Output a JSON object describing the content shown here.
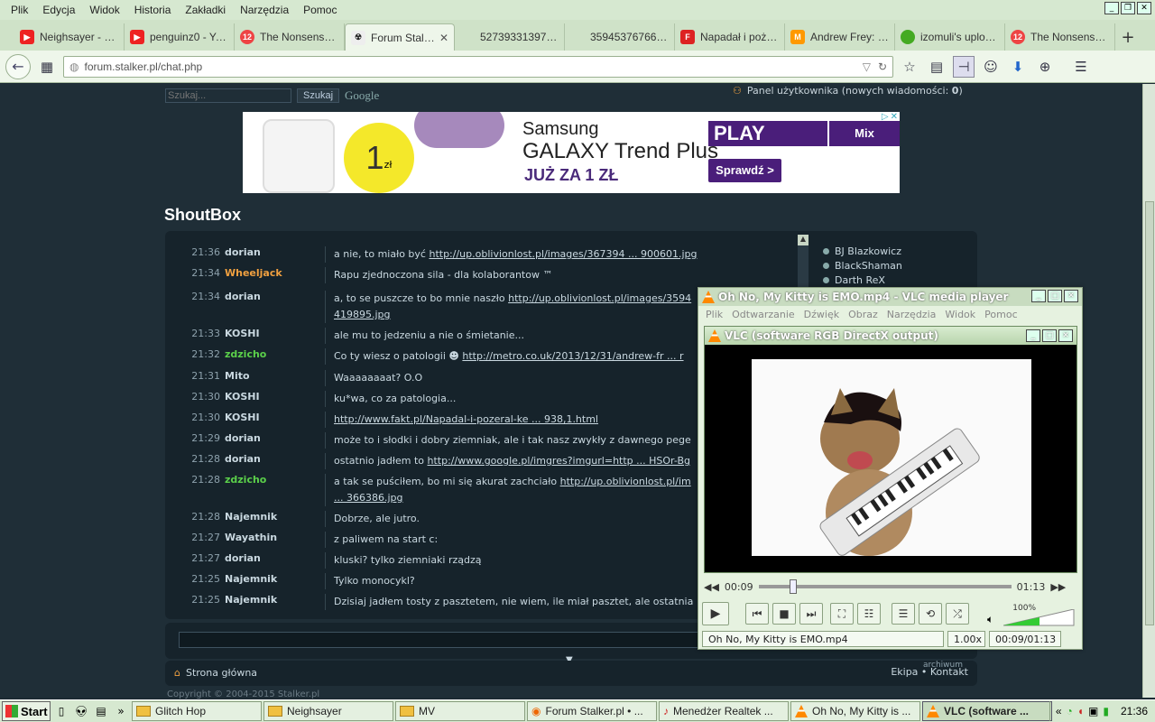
{
  "menubar": {
    "items": [
      "Plik",
      "Edycja",
      "Widok",
      "Historia",
      "Zakładki",
      "Narzędzia",
      "Pomoc"
    ]
  },
  "tabs": [
    {
      "label": "Neighsayer - Fill...",
      "icon": "youtube-icon",
      "color": "#e22"
    },
    {
      "label": "penguinz0 - Yo...",
      "icon": "youtube-icon",
      "color": "#e22"
    },
    {
      "label": "The Nonsense ...",
      "icon": "12-icon",
      "color": "#e44"
    },
    {
      "label": "Forum Stalk...",
      "icon": "radiation-icon",
      "color": "#333",
      "active": true
    },
    {
      "label": "5273933139752114...",
      "icon": "blank-icon",
      "color": ""
    },
    {
      "label": "3594537676676241...",
      "icon": "blank-icon",
      "color": ""
    },
    {
      "label": "Napadał i poże...",
      "icon": "fakt-icon",
      "color": "#d22"
    },
    {
      "label": "Andrew Frey: O...",
      "icon": "m-icon",
      "color": "#f90"
    },
    {
      "label": "izomuli's upload...",
      "icon": "green-dot-icon",
      "color": "#4a2"
    },
    {
      "label": "The Nonsense ...",
      "icon": "12-icon",
      "color": "#e44"
    }
  ],
  "url": "forum.stalker.pl/chat.php",
  "search": {
    "placeholder": "Szukaj...",
    "button": "Szukaj",
    "google": "Google"
  },
  "panel": {
    "prefix": "Panel użytkownika (nowych wiadomości: ",
    "count": "0",
    "suffix": ")"
  },
  "ad": {
    "line1": "Samsung",
    "line2": "GALAXY Trend Plus",
    "line3": "JUŻ ZA 1 ZŁ",
    "price": "1",
    "unit": "zł",
    "brand": "PLAY",
    "mix": "Mix",
    "cta": "Sprawdź >"
  },
  "shoutbox": {
    "title": "ShoutBox",
    "rows": [
      {
        "time": "21:36",
        "user": "dorian",
        "cls": "",
        "text": "a nie, to miało być ",
        "link": "http://up.oblivionlost.pl/images/367394 ... 900601.jpg"
      },
      {
        "time": "21:34",
        "user": "Wheeljack",
        "cls": "orange",
        "text": "Rapu zjednoczona sila - dla kolaborantow ™",
        "link": ""
      },
      {
        "time": "21:34",
        "user": "dorian",
        "cls": "",
        "text": "a, to se puszcze to bo mnie naszło ",
        "link": "http://up.oblivionlost.pl/images/3594",
        "text2": "419895.jpg"
      },
      {
        "time": "21:33",
        "user": "KOSHI",
        "cls": "",
        "text": "ale mu to jedzeniu a nie o śmietanie...",
        "link": ""
      },
      {
        "time": "21:32",
        "user": "zdzicho",
        "cls": "green",
        "text": "Co ty wiesz o patologii ☻ ",
        "link": "http://metro.co.uk/2013/12/31/andrew-fr ... r"
      },
      {
        "time": "21:31",
        "user": "Mito",
        "cls": "",
        "text": "Waaaaaaaat? O.O",
        "link": ""
      },
      {
        "time": "21:30",
        "user": "KOSHI",
        "cls": "",
        "text": "ku*wa, co za patologia...",
        "link": ""
      },
      {
        "time": "21:30",
        "user": "KOSHI",
        "cls": "",
        "text": "",
        "link": "http://www.fakt.pl/Napadal-i-pozeral-ke ... 938,1.html"
      },
      {
        "time": "21:29",
        "user": "dorian",
        "cls": "",
        "text": "może to i słodki i dobry ziemniak, ale i tak nasz zwykły z dawnego pege",
        "link": ""
      },
      {
        "time": "21:28",
        "user": "dorian",
        "cls": "",
        "text": "ostatnio jadłem to ",
        "link": "http://www.google.pl/imgres?imgurl=http ... HSOr-Bg"
      },
      {
        "time": "21:28",
        "user": "zdzicho",
        "cls": "green",
        "text": "a tak se puściłem, bo mi się akurat zachciało ",
        "link": "http://up.oblivionlost.pl/im",
        "text2": "... 366386.jpg"
      },
      {
        "time": "21:28",
        "user": "Najemnik",
        "cls": "",
        "text": "Dobrze, ale jutro.",
        "link": ""
      },
      {
        "time": "21:27",
        "user": "Wayathin",
        "cls": "",
        "text": "z paliwem na start c:",
        "link": ""
      },
      {
        "time": "21:27",
        "user": "dorian",
        "cls": "",
        "text": "kluski? tylko ziemniaki rządzą",
        "link": ""
      },
      {
        "time": "21:25",
        "user": "Najemnik",
        "cls": "",
        "text": "Tylko monocykl?",
        "link": ""
      },
      {
        "time": "21:25",
        "user": "Najemnik",
        "cls": "",
        "text": "Dzisiaj jadłem tosty z pasztetem, nie wiem, ile miał pasztet, ale ostatnia",
        "link": ""
      }
    ],
    "users": [
      "BJ Blazkowicz",
      "BlackShaman",
      "Darth ReX"
    ]
  },
  "footer": {
    "home": "Strona główna",
    "ekipa": "Ekipa • Kontakt",
    "archiwum": "archiwum",
    "copyright": "Copyright © 2004-2015 Stalker.pl"
  },
  "vlc": {
    "title": "Oh No, My Kitty is EMO.mp4 - VLC media player",
    "menu": [
      "Plik",
      "Odtwarzanie",
      "Dźwięk",
      "Obraz",
      "Narzędzia",
      "Widok",
      "Pomoc"
    ],
    "inner_title": "VLC (software RGB DirectX output)",
    "elapsed": "00:09",
    "total": "01:13",
    "progress": 0.123,
    "volume": "100%",
    "status_file": "Oh No, My Kitty is EMO.mp4",
    "speed": "1.00x",
    "status_time": "00:09/01:13"
  },
  "taskbar": {
    "start": "Start",
    "tasks": [
      {
        "label": "Glitch Hop",
        "icon": "folder-icon"
      },
      {
        "label": "Neighsayer",
        "icon": "folder-icon"
      },
      {
        "label": "MV",
        "icon": "folder-icon"
      },
      {
        "label": "Forum Stalker.pl • ...",
        "icon": "firefox-icon"
      },
      {
        "label": "Menedżer Realtek ...",
        "icon": "realtek-icon"
      },
      {
        "label": "Oh No, My Kitty is ...",
        "icon": "vlc-icon"
      },
      {
        "label": "VLC (software ...",
        "icon": "vlc-icon",
        "active": true
      }
    ],
    "clock": "21:36"
  }
}
